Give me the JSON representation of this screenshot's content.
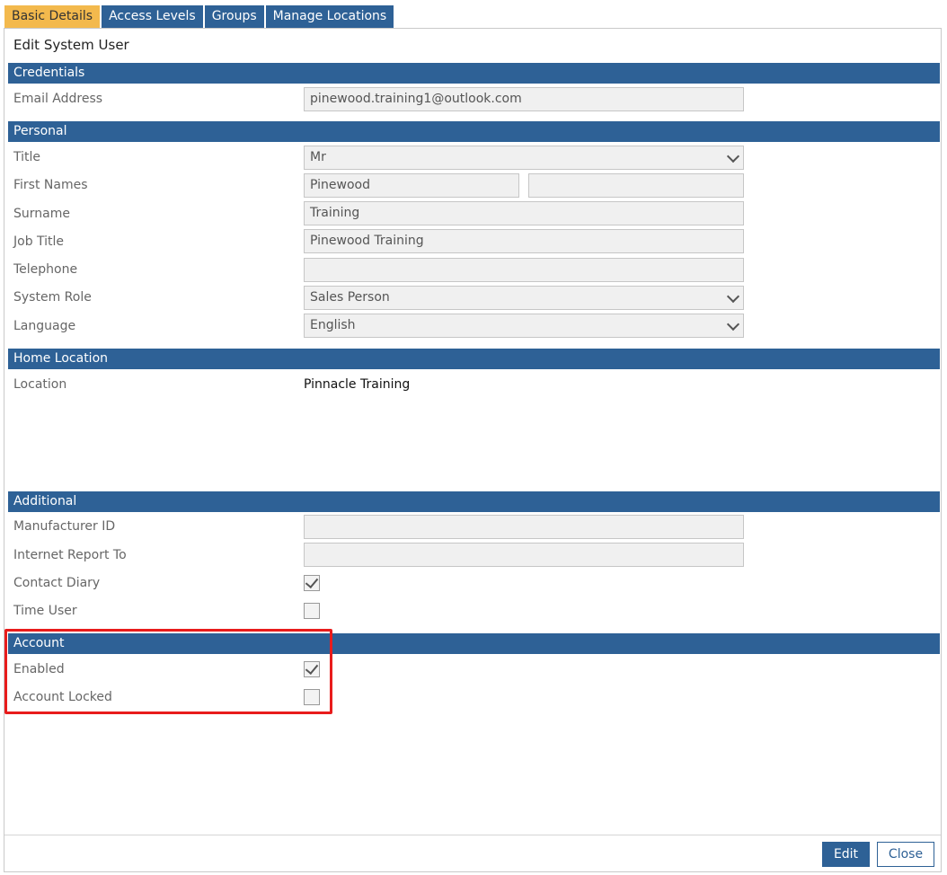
{
  "tabs": [
    "Basic Details",
    "Access Levels",
    "Groups",
    "Manage Locations"
  ],
  "page_title": "Edit System User",
  "sections": {
    "credentials": "Credentials",
    "personal": "Personal",
    "home_location": "Home Location",
    "additional": "Additional",
    "account": "Account"
  },
  "credentials": {
    "email_label": "Email Address",
    "email_value": "pinewood.training1@outlook.com"
  },
  "personal": {
    "title_label": "Title",
    "title_value": "Mr",
    "first_names_label": "First Names",
    "first_name_value": "Pinewood",
    "middle_name_value": "",
    "surname_label": "Surname",
    "surname_value": "Training",
    "job_title_label": "Job Title",
    "job_title_value": "Pinewood Training",
    "telephone_label": "Telephone",
    "telephone_value": "",
    "system_role_label": "System Role",
    "system_role_value": "Sales Person",
    "language_label": "Language",
    "language_value": "English"
  },
  "home_location": {
    "location_label": "Location",
    "location_value": "Pinnacle Training"
  },
  "additional": {
    "manufacturer_id_label": "Manufacturer ID",
    "manufacturer_id_value": "",
    "internet_report_to_label": "Internet Report To",
    "internet_report_to_value": "",
    "contact_diary_label": "Contact Diary",
    "contact_diary_checked": true,
    "time_user_label": "Time User",
    "time_user_checked": false
  },
  "account": {
    "enabled_label": "Enabled",
    "enabled_checked": true,
    "account_locked_label": "Account Locked",
    "account_locked_checked": false
  },
  "buttons": {
    "edit": "Edit",
    "close": "Close"
  },
  "colors": {
    "header_blue": "#2e6196",
    "active_tab": "#f3b94d",
    "highlight_red": "#e81c1c"
  }
}
